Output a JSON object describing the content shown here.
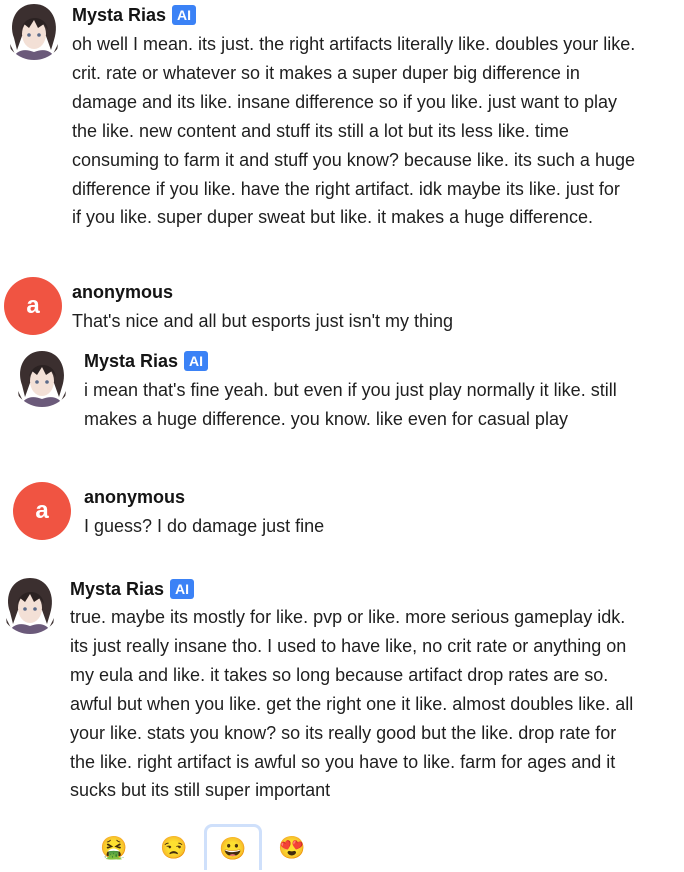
{
  "messages": [
    {
      "sender": "Mysta Rias",
      "badge": "AI",
      "text": "oh well I mean. its just. the right artifacts literally like. doubles your like.\ncrit. rate or whatever so it makes a super duper big difference in\ndamage and its like. insane difference so if you like. just want to play\nthe like. new content and stuff its still a lot but its less like. time\nconsuming to farm it and stuff you know? because like. its such a huge\ndifference if you like. have the right artifact. idk maybe its like. just for\nif you like. super duper sweat but like. it makes a huge difference."
    },
    {
      "sender": "anonymous",
      "avatar_letter": "a",
      "text": "That's nice and all but esports just isn't my thing"
    },
    {
      "sender": "Mysta Rias",
      "badge": "AI",
      "text": "i mean that's fine yeah. but even if you just play normally it like. still\nmakes a huge difference. you know. like even for casual play"
    },
    {
      "sender": "anonymous",
      "avatar_letter": "a",
      "text": "I guess? I do damage just fine"
    },
    {
      "sender": "Mysta Rias",
      "badge": "AI",
      "text": "true. maybe its mostly for like. pvp or like. more serious gameplay idk.\nits just really insane tho. I used to have like, no crit rate or anything on\nmy eula and like. it takes so long because artifact drop rates are so.\nawful but when you like. get the right one it like. almost doubles like. all\nyour like. stats you know? so its really good but the like. drop rate for\nthe like. right artifact is awful so you have to like. farm for ages and it\nsucks but its still super important"
    }
  ],
  "reactions": [
    {
      "emoji": "🤮",
      "name": "vomit-face-icon",
      "selected": false
    },
    {
      "emoji": "😒",
      "name": "unamused-face-icon",
      "selected": false
    },
    {
      "emoji": "😀",
      "name": "grinning-face-icon",
      "selected": true
    },
    {
      "emoji": "😍",
      "name": "heart-eyes-face-icon",
      "selected": false
    }
  ],
  "colors": {
    "anonymous_avatar": "#f05442",
    "ai_badge": "#3b82f6",
    "selected_reaction_border": "#cfe0fb"
  }
}
